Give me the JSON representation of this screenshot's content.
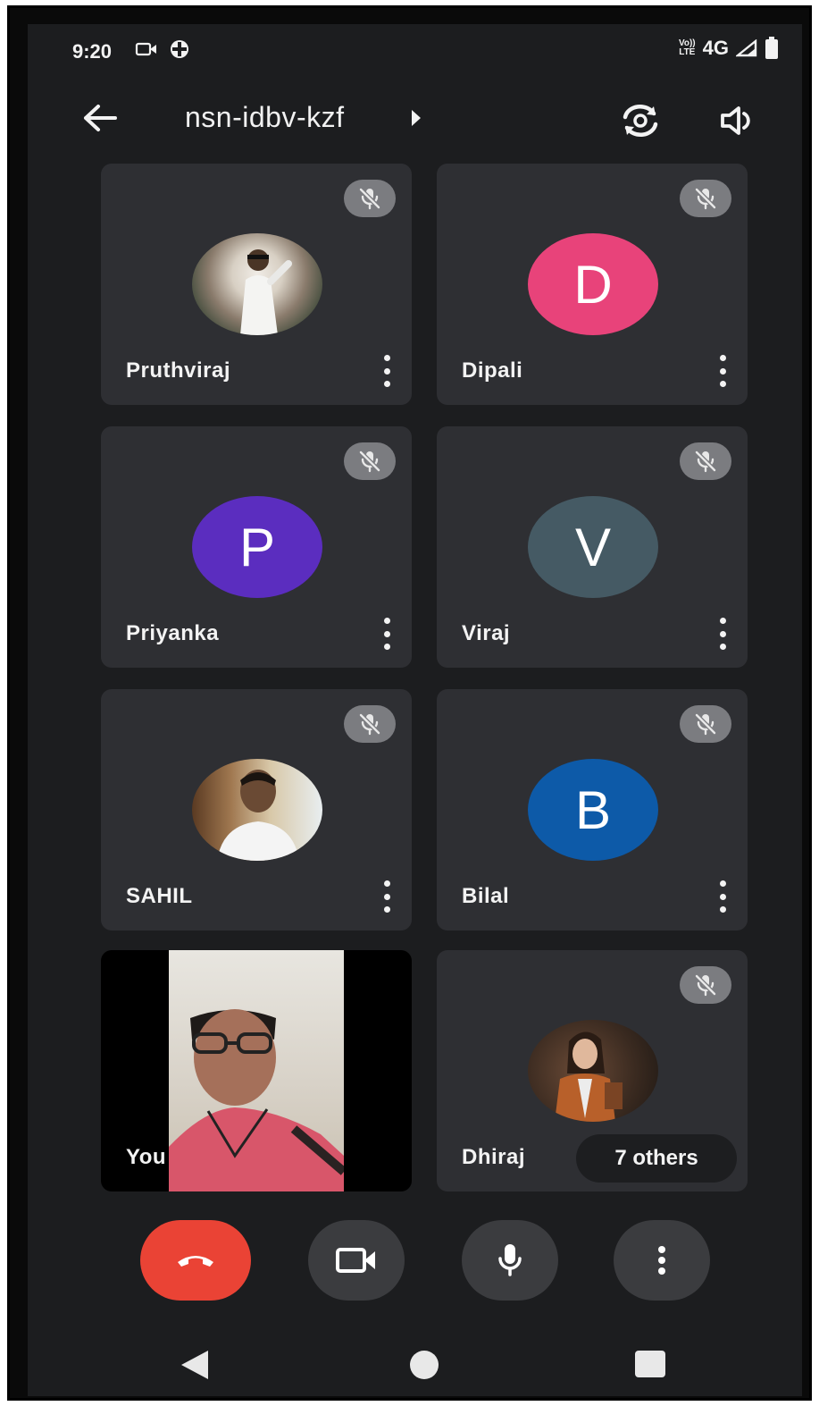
{
  "status_bar": {
    "time": "9:20",
    "volte_top": "Vo))",
    "volte_bottom": "LTE",
    "network": "4G"
  },
  "header": {
    "meeting_code": "nsn-idbv-kzf",
    "icons": [
      "back-arrow-icon",
      "caret-right-icon",
      "switch-camera-icon",
      "speaker-icon"
    ]
  },
  "participants": [
    {
      "name": "Pruthviraj",
      "avatar_type": "photo",
      "muted": true
    },
    {
      "name": "Dipali",
      "initial": "D",
      "avatar_color": "#e8437a",
      "muted": true
    },
    {
      "name": "Priyanka",
      "initial": "P",
      "avatar_color": "#5b2dbf",
      "muted": true
    },
    {
      "name": "Viraj",
      "initial": "V",
      "avatar_color": "#455a64",
      "muted": true
    },
    {
      "name": "SAHIL",
      "avatar_type": "photo",
      "muted": true
    },
    {
      "name": "Bilal",
      "initial": "B",
      "avatar_color": "#0d5aa8",
      "muted": true
    },
    {
      "name": "You",
      "avatar_type": "self-video",
      "muted": false
    },
    {
      "name": "Dhiraj",
      "avatar_type": "photo",
      "muted": true
    }
  ],
  "others_pill": "7 others",
  "controls": {
    "end_call_color": "#ea4335",
    "buttons": [
      "end-call",
      "camera",
      "microphone",
      "more-options"
    ]
  }
}
